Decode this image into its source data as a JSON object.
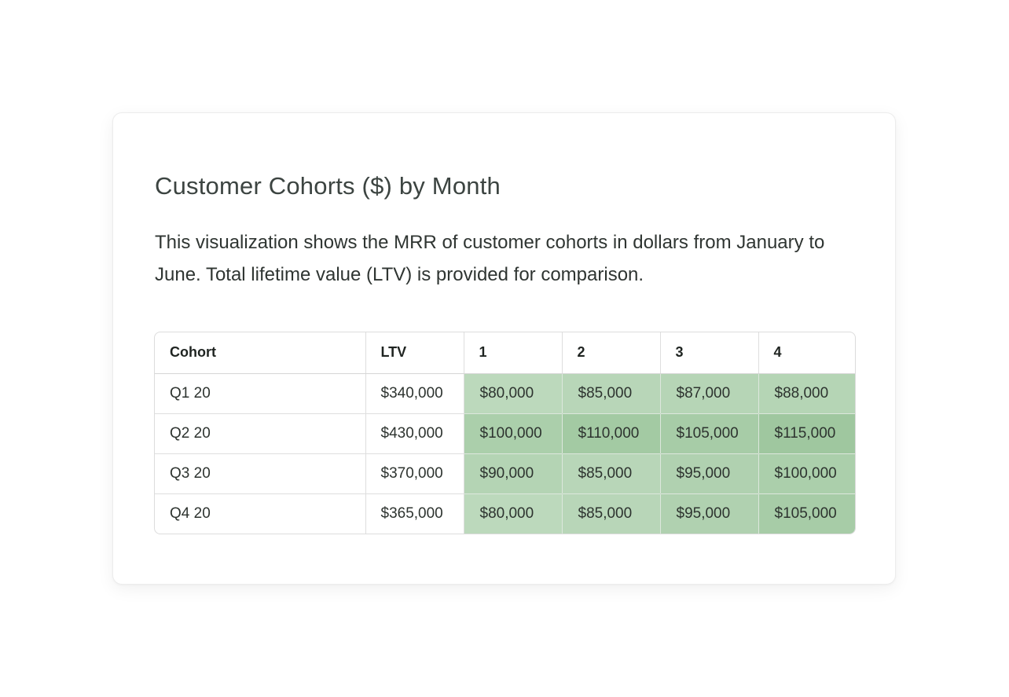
{
  "card": {
    "title": "Customer Cohorts ($) by Month",
    "description": "This visualization shows the MRR of customer cohorts in dollars from January to June. Total lifetime value (LTV) is provided for comparison."
  },
  "chart_data": {
    "type": "heatmap",
    "columns": [
      "Cohort",
      "LTV",
      "1",
      "2",
      "3",
      "4"
    ],
    "rows": [
      {
        "cohort": "Q1 20",
        "ltv": "$340,000",
        "cells": [
          "$80,000",
          "$85,000",
          "$87,000",
          "$88,000"
        ],
        "values": [
          80000,
          85000,
          87000,
          88000
        ]
      },
      {
        "cohort": "Q2 20",
        "ltv": "$430,000",
        "cells": [
          "$100,000",
          "$110,000",
          "$105,000",
          "$115,000"
        ],
        "values": [
          100000,
          110000,
          105000,
          115000
        ]
      },
      {
        "cohort": "Q3 20",
        "ltv": "$370,000",
        "cells": [
          "$90,000",
          "$85,000",
          "$95,000",
          "$100,000"
        ],
        "values": [
          90000,
          85000,
          95000,
          100000
        ]
      },
      {
        "cohort": "Q4 20",
        "ltv": "$365,000",
        "cells": [
          "$80,000",
          "$85,000",
          "$95,000",
          "$105,000"
        ],
        "values": [
          80000,
          85000,
          95000,
          105000
        ]
      }
    ],
    "color_scale": {
      "low": "#bcd9bc",
      "high": "#9fc79f"
    }
  }
}
